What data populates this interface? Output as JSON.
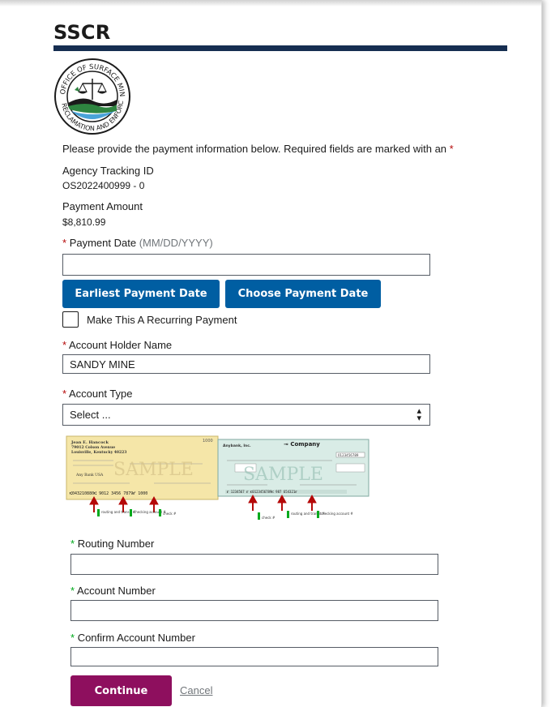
{
  "header": {
    "title": "SSCR"
  },
  "seal": {
    "text": "OFFICE OF SURFACE MINING RECLAMATION AND ENFORCEMENT"
  },
  "intro": {
    "text": "Please provide the payment information below. Required fields are marked with an",
    "asterisk": "*"
  },
  "tracking": {
    "label": "Agency Tracking ID",
    "value": "OS2022400999 - 0"
  },
  "amount": {
    "label": "Payment Amount",
    "value": "$8,810.99"
  },
  "payment_date": {
    "asterisk": "*",
    "label": "Payment Date",
    "hint": "(MM/DD/YYYY)",
    "value": ""
  },
  "buttons": {
    "earliest": "Earliest Payment Date",
    "choose": "Choose Payment Date"
  },
  "recurring": {
    "label": "Make This A Recurring Payment",
    "checked": false
  },
  "account_holder": {
    "asterisk": "*",
    "label": "Account Holder Name",
    "value": "SANDY MINE"
  },
  "account_type": {
    "asterisk": "*",
    "label": "Account Type",
    "selected": "Select ..."
  },
  "check_sample": {
    "check1": {
      "name": "Jean E. Hancock",
      "address1": "79012 Colson Avenue",
      "address2": "Louisville, Kentucky 40223",
      "number": "1000",
      "bank": "Any Bank USA",
      "micr": "⑆043210880⑆ 9012 3456 7879⑈ 1000",
      "watermark": "SAMPLE",
      "captions": [
        "routing and transit #",
        "checking account #",
        "check #"
      ]
    },
    "check2": {
      "company": "Anybank, Inc.",
      "payee_company": "Company",
      "number": "0123456789",
      "watermark": "SAMPLE",
      "captions": [
        "check #",
        "routing and transit #",
        "checking account #"
      ]
    }
  },
  "routing": {
    "asterisk": "*",
    "label": "Routing Number",
    "value": ""
  },
  "account_number": {
    "asterisk": "*",
    "label": "Account Number",
    "value": ""
  },
  "confirm_account": {
    "asterisk": "*",
    "label": "Confirm Account Number",
    "value": ""
  },
  "actions": {
    "continue": "Continue",
    "cancel": "Cancel"
  },
  "colors": {
    "primary": "#005ea2",
    "continue": "#8e0f5e",
    "rule": "#162e51",
    "required": "#b50909"
  }
}
